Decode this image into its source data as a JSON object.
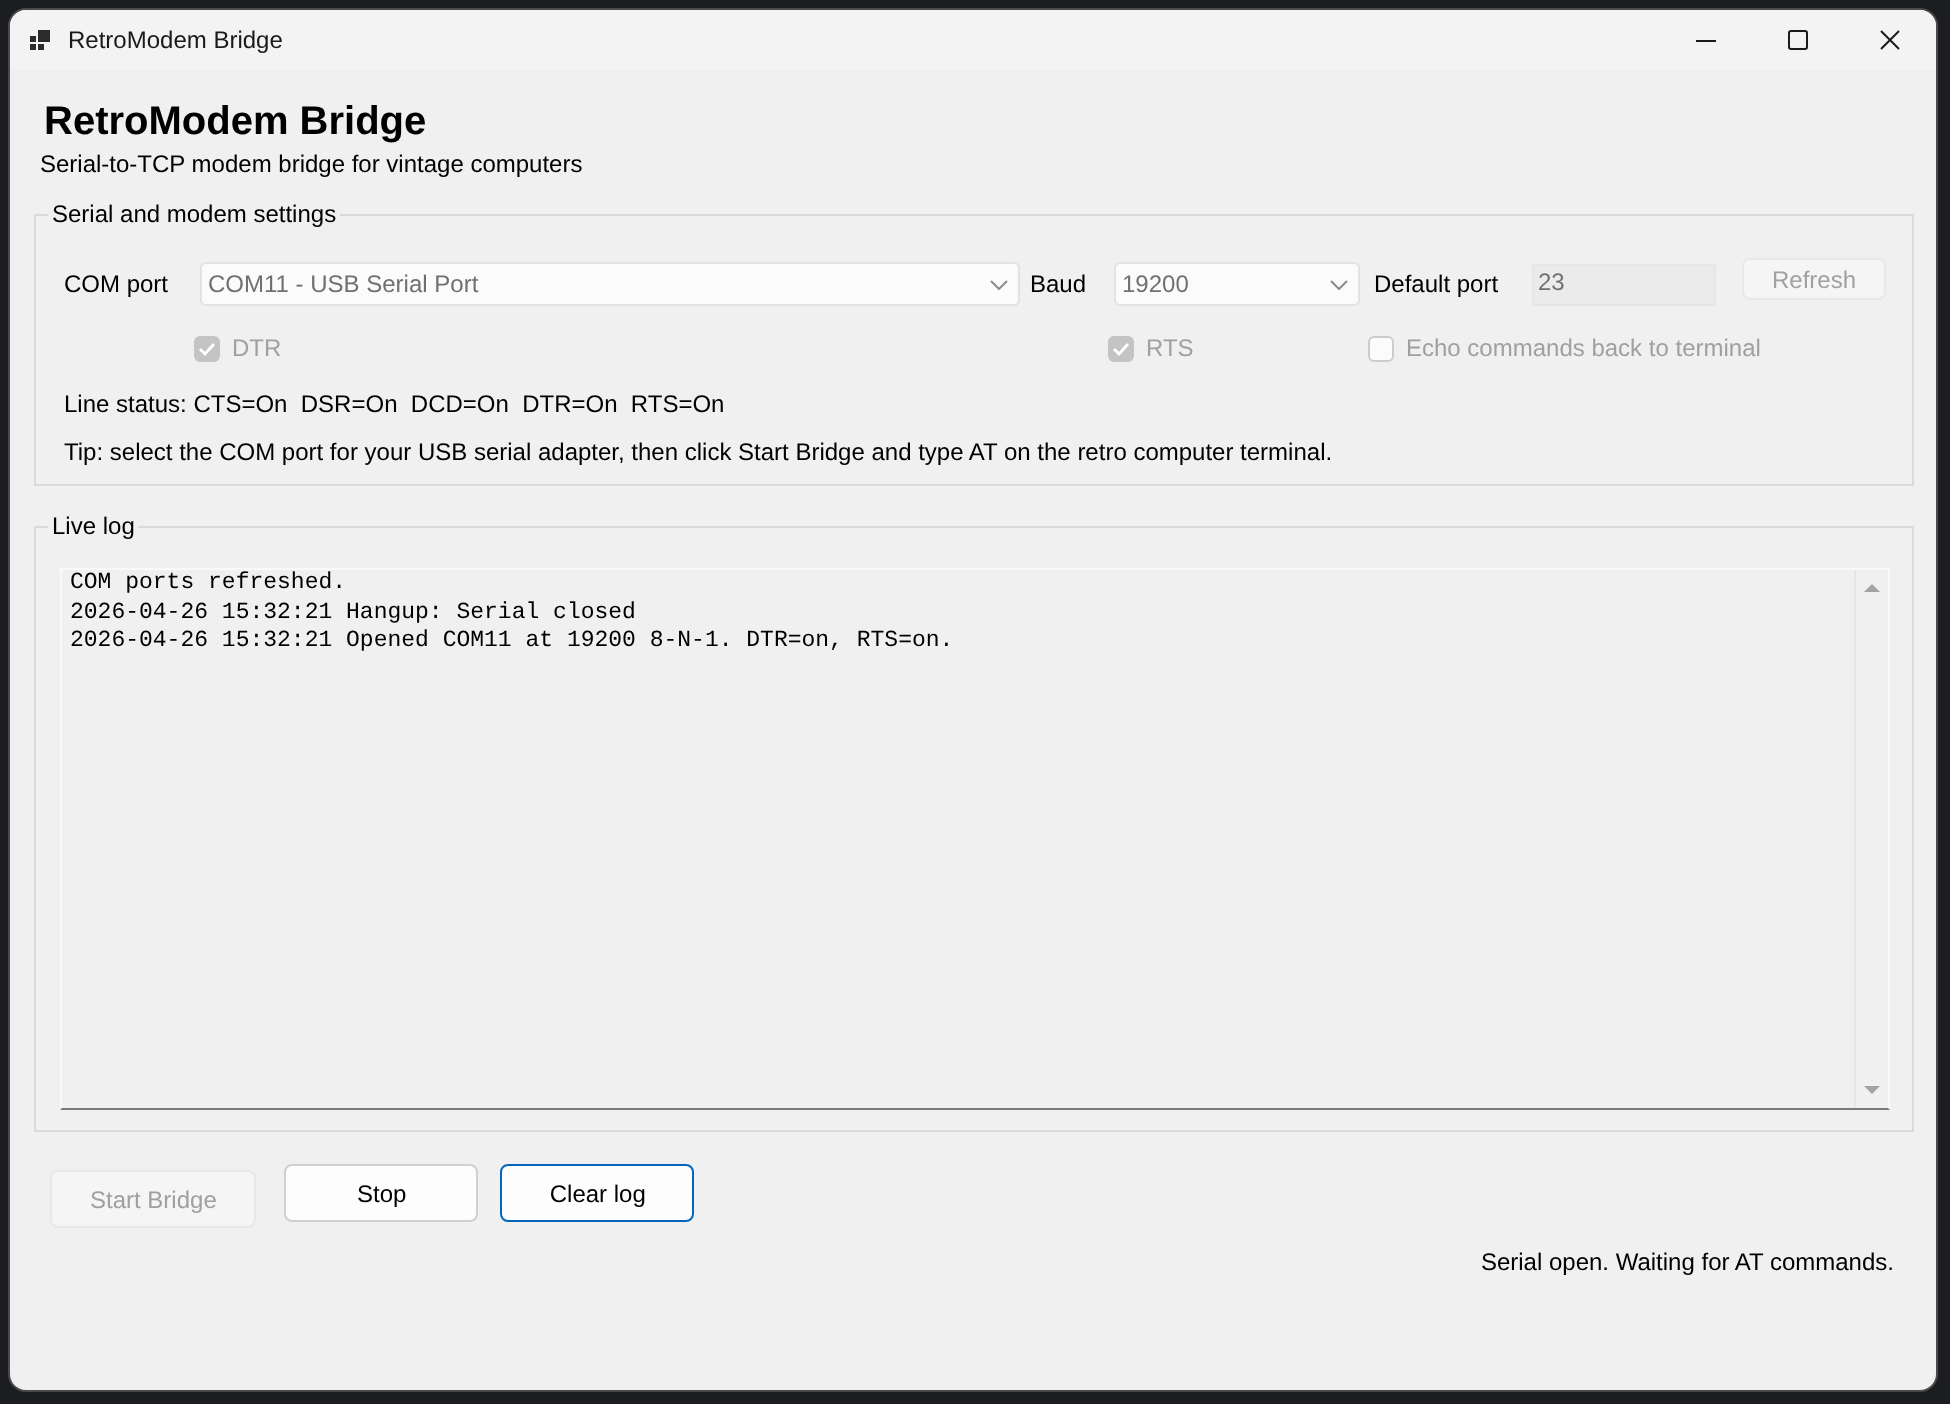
{
  "window": {
    "title": "RetroModem Bridge"
  },
  "header": {
    "title": "RetroModem Bridge",
    "subtitle": "Serial-to-TCP modem bridge for vintage computers"
  },
  "settings": {
    "legend": "Serial and modem settings",
    "com_port": {
      "label": "COM port",
      "value": "COM11 - USB Serial Port",
      "disabled": true
    },
    "baud": {
      "label": "Baud",
      "value": "19200",
      "disabled": true
    },
    "default_port": {
      "label": "Default port",
      "value": "23",
      "disabled": true
    },
    "refresh_button": {
      "label": "Refresh",
      "disabled": true
    },
    "checkboxes": [
      {
        "label": "DTR",
        "checked": true,
        "disabled": true
      },
      {
        "label": "RTS",
        "checked": true,
        "disabled": true
      },
      {
        "label": "Echo commands back to terminal",
        "checked": false,
        "disabled": true
      }
    ],
    "line_status": "Line status: CTS=On  DSR=On  DCD=On  DTR=On  RTS=On",
    "tip": "Tip: select the COM port for your USB serial adapter, then click Start Bridge and type AT on the retro computer terminal."
  },
  "live_log": {
    "legend": "Live log",
    "lines": [
      "COM ports refreshed.",
      "2026-04-26 15:32:21 Hangup: Serial closed",
      "2026-04-26 15:32:21 Opened COM11 at 19200 8-N-1. DTR=on, RTS=on."
    ]
  },
  "buttons": [
    {
      "label": "Start Bridge",
      "disabled": true,
      "focused": false
    },
    {
      "label": "Stop",
      "disabled": false,
      "focused": false
    },
    {
      "label": "Clear log",
      "disabled": false,
      "focused": true
    }
  ],
  "status_bar": "Serial open. Waiting for AT commands."
}
